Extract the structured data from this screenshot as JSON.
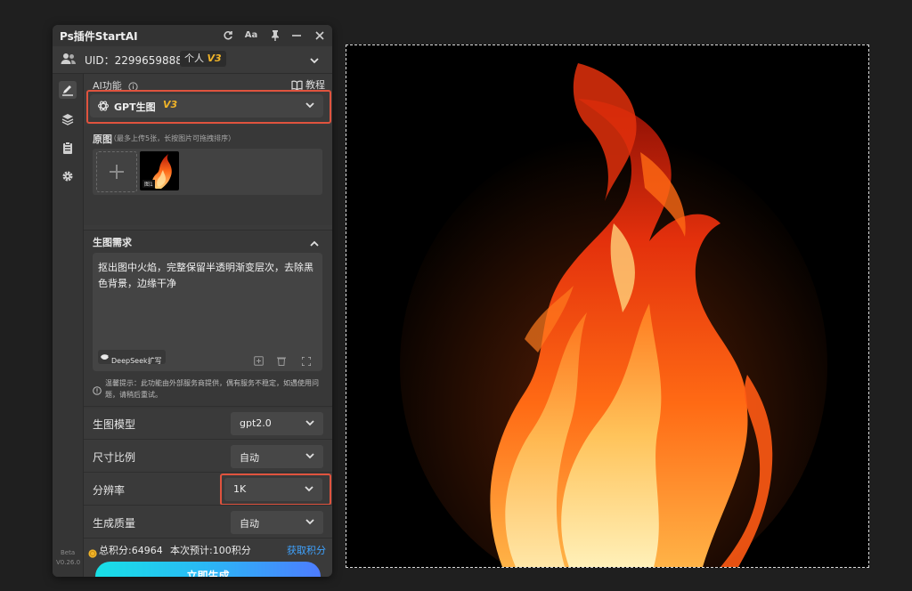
{
  "panel": {
    "title": "Ps插件StartAI",
    "uid_label": "UID：2299659888",
    "account_tier": "个人",
    "account_version": "V3"
  },
  "ai_function": {
    "label": "AI功能",
    "tutorial_label": "教程",
    "selected": "GPT生图",
    "selected_version": "V3"
  },
  "source_images": {
    "label": "原图",
    "hint": "（最多上传5张，长按图片可拖拽排序）",
    "thumb_badge": "图1"
  },
  "prompt": {
    "section_label": "生图需求",
    "text": "抠出图中火焰，完整保留半透明渐变层次，去除黑色背景，边缘干净",
    "expand_button": "DeepSeek扩写",
    "notice": "温馨提示：此功能由外部服务商提供，偶有服务不稳定，如遇使用问题，请稍后重试。"
  },
  "settings": [
    {
      "label": "生图模型",
      "value": "gpt2.0"
    },
    {
      "label": "尺寸比例",
      "value": "自动"
    },
    {
      "label": "分辨率",
      "value": "1K"
    },
    {
      "label": "生成质量",
      "value": "自动"
    }
  ],
  "credits": {
    "total": "总积分:64964",
    "cost": "本次预计:100积分",
    "get_link": "获取积分"
  },
  "generate_button": "立即生成",
  "version": {
    "stage": "Beta",
    "number": "V0.26.0"
  },
  "colors": {
    "accent": "#e0533e",
    "link": "#3fa3ff",
    "version_badge": "#f0b429",
    "gradient_start": "#18e0e6",
    "gradient_end": "#4d7cff"
  }
}
